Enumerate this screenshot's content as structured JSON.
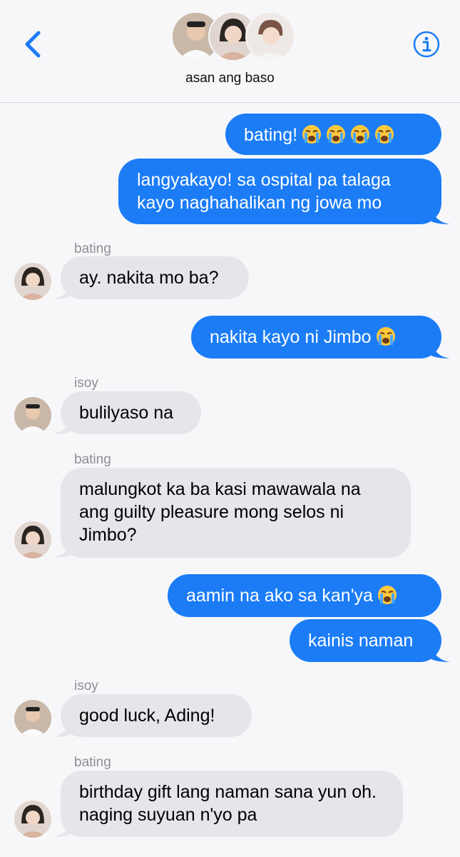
{
  "header": {
    "title": "asan ang baso",
    "back_icon": "chevron-left-icon",
    "info_icon": "info-icon",
    "accent": "#1b7cf6"
  },
  "colors": {
    "outgoing": "#1b7cf6",
    "incoming": "#e5e5ea",
    "background": "#f7f7f9"
  },
  "messages": [
    {
      "dir": "out",
      "text": "bating!",
      "emoji": [
        "crying-face-icon",
        "crying-face-icon",
        "crying-face-icon",
        "crying-face-icon"
      ]
    },
    {
      "dir": "out",
      "text": "langyakayo! sa ospital pa talaga kayo naghahalikan ng jowa mo"
    },
    {
      "dir": "in",
      "sender": "bating",
      "text": "ay. nakita mo ba?"
    },
    {
      "dir": "out",
      "text": "nakita kayo ni Jimbo",
      "emoji": [
        "crying-face-icon"
      ]
    },
    {
      "dir": "in",
      "sender": "isoy",
      "text": "bulilyaso na"
    },
    {
      "dir": "in",
      "sender": "bating",
      "text": "malungkot ka ba kasi mawawala na ang guilty pleasure mong selos ni Jimbo?"
    },
    {
      "dir": "out",
      "text": "aamin na ako sa kan'ya",
      "emoji": [
        "crying-face-icon"
      ]
    },
    {
      "dir": "out",
      "text": "kainis naman"
    },
    {
      "dir": "in",
      "sender": "isoy",
      "text": "good luck, Ading!"
    },
    {
      "dir": "in",
      "sender": "bating",
      "text": "birthday gift lang naman sana yun oh. naging suyuan n'yo pa"
    }
  ]
}
